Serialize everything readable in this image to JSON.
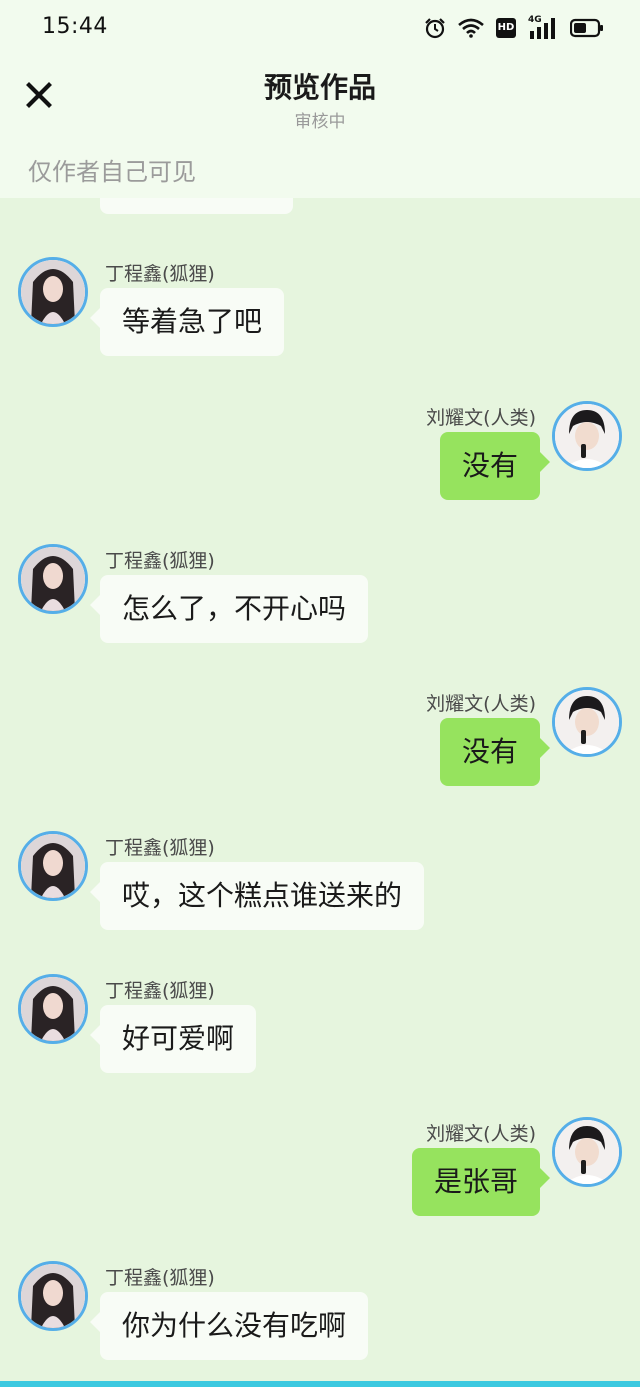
{
  "status_bar": {
    "time": "15:44",
    "icons": [
      "alarm-icon",
      "wifi-icon",
      "hd-icon",
      "signal-4g-icon",
      "battery-icon"
    ],
    "network_label": "4G",
    "hd_label": "HD"
  },
  "header": {
    "close_icon": "close-icon",
    "title": "预览作品",
    "subtitle": "审核中",
    "visibility_note": "仅作者自己可见"
  },
  "characters": {
    "fox": {
      "name": "丁程鑫(狐狸)"
    },
    "human": {
      "name": "刘耀文(人类)"
    }
  },
  "messages": [
    {
      "side": "left",
      "name": "丁程鑫(狐狸)",
      "text": "等着急了吧"
    },
    {
      "side": "right",
      "name": "刘耀文(人类)",
      "text": "没有"
    },
    {
      "side": "left",
      "name": "丁程鑫(狐狸)",
      "text": "怎么了，不开心吗"
    },
    {
      "side": "right",
      "name": "刘耀文(人类)",
      "text": "没有"
    },
    {
      "side": "left",
      "name": "丁程鑫(狐狸)",
      "text": "哎，这个糕点谁送来的"
    },
    {
      "side": "left",
      "name": "丁程鑫(狐狸)",
      "text": "好可爱啊"
    },
    {
      "side": "right",
      "name": "刘耀文(人类)",
      "text": "是张哥"
    },
    {
      "side": "left",
      "name": "丁程鑫(狐狸)",
      "text": "你为什么没有吃啊"
    }
  ],
  "colors": {
    "background": "#e6f5de",
    "header_background": "#f2fbee",
    "left_bubble": "#f8fcf6",
    "right_bubble": "#96e35e",
    "avatar_border": "#55aee8",
    "bottom_bar": "#3cc9e0"
  }
}
